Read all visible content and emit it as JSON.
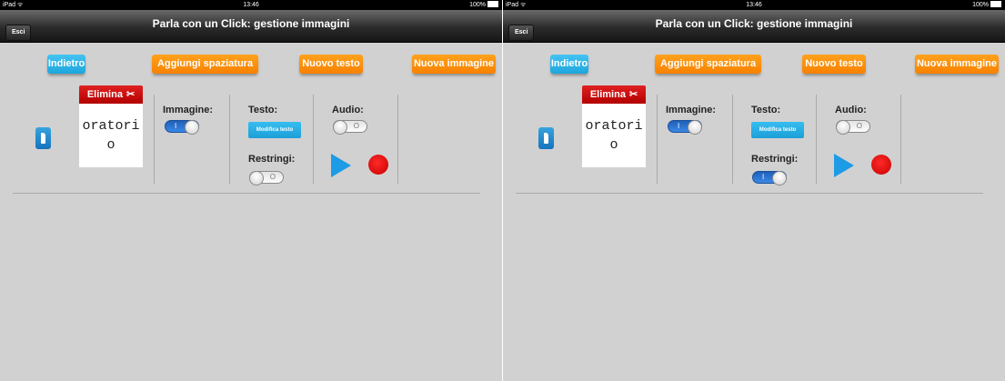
{
  "screens": [
    {
      "status": {
        "left": "iPad ᯤ",
        "time": "13:46",
        "battery": "100%"
      },
      "nav": {
        "title": "Parla con un Click: gestione immagini",
        "exit_label": "Esci"
      },
      "toolbar": {
        "back_label": "Indietro",
        "add_spacing_label": "Aggiungi spaziatura",
        "new_text_label": "Nuovo testo",
        "new_image_label": "Nuova immagine"
      },
      "item": {
        "delete_label": "Elimina",
        "card_text": "oratorio",
        "image_label": "Immagine:",
        "text_label": "Testo:",
        "modify_text_label": "Modifica testo",
        "shrink_label": "Restringi:",
        "audio_label": "Audio:",
        "switches": {
          "image_on": true,
          "audio_on": false,
          "shrink_on": false
        }
      }
    },
    {
      "status": {
        "left": "iPad ᯤ",
        "time": "13:46",
        "battery": "100%"
      },
      "nav": {
        "title": "Parla con un Click: gestione immagini",
        "exit_label": "Esci"
      },
      "toolbar": {
        "back_label": "Indietro",
        "add_spacing_label": "Aggiungi spaziatura",
        "new_text_label": "Nuovo testo",
        "new_image_label": "Nuova immagine"
      },
      "item": {
        "delete_label": "Elimina",
        "card_text": "oratorio",
        "image_label": "Immagine:",
        "text_label": "Testo:",
        "modify_text_label": "Modifica testo",
        "shrink_label": "Restringi:",
        "audio_label": "Audio:",
        "switches": {
          "image_on": true,
          "audio_on": false,
          "shrink_on": true
        }
      }
    }
  ],
  "colors": {
    "blue_button": "#1ea6dd",
    "orange_button": "#f78100",
    "delete_red": "#c40000",
    "switch_on_blue": "#2a74d0",
    "record_red": "#d00000",
    "play_blue": "#1d9be6",
    "background": "#d1d1d1"
  },
  "icons": {
    "handle": "drag-handle-icon",
    "delete": "scissors-icon",
    "play": "play-icon",
    "record": "record-icon",
    "wifi": "wifi-icon",
    "battery": "battery-icon"
  }
}
